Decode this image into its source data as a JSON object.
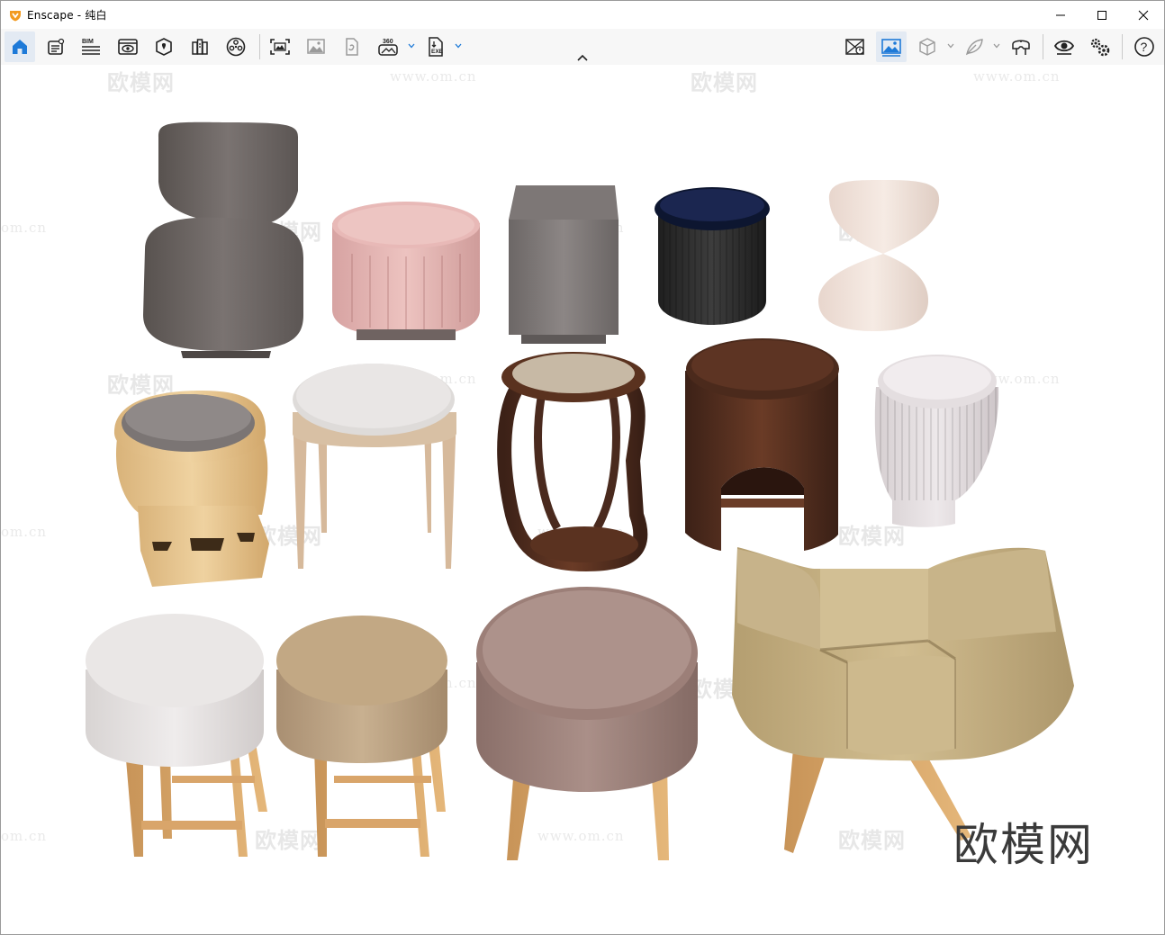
{
  "window": {
    "app_name": "Enscape",
    "title": "Enscape - 纯白",
    "controls": [
      "minimize-icon",
      "maximize-icon",
      "close-icon"
    ]
  },
  "toolbar": {
    "left_tools": [
      {
        "icon": "home-icon",
        "active": true
      },
      {
        "icon": "project-info-icon"
      },
      {
        "icon": "bim-icon",
        "label": "BIM"
      },
      {
        "icon": "view-management-icon"
      },
      {
        "icon": "site-context-icon"
      },
      {
        "icon": "asset-library-icon"
      },
      {
        "icon": "materials-icon"
      },
      {
        "icon": "screenshot-icon"
      },
      {
        "icon": "batch-render-icon"
      },
      {
        "icon": "panorama-upload-icon"
      },
      {
        "icon": "panorama-360-icon",
        "label": "360"
      },
      {
        "icon": "export-exe-icon",
        "label": "EXE"
      }
    ],
    "right_tools": [
      {
        "icon": "hide-objects-icon"
      },
      {
        "icon": "capture-view-icon",
        "active": true
      },
      {
        "icon": "cube-section-icon"
      },
      {
        "icon": "feather-icon"
      },
      {
        "icon": "vr-headset-icon"
      },
      {
        "icon": "eye-visibility-icon"
      },
      {
        "icon": "settings-icon"
      },
      {
        "icon": "help-icon",
        "label": "?"
      }
    ]
  },
  "viewport": {
    "watermark_cn": "欧模网",
    "watermark_url": "www.om.cn",
    "watermark_url_cut": "om.cn",
    "brand_watermark": "欧模网",
    "colors": {
      "gray_fabric": "#6e6968",
      "pink_velvet": "#e6b7b5",
      "dark_walnut": "#4a2a1e",
      "pale_wood": "#e9c891",
      "tan_fabric": "#c2a884",
      "beige_cushion": "#c9b485"
    }
  }
}
